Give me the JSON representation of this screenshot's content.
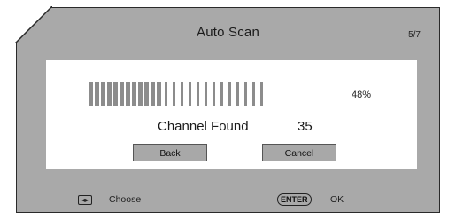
{
  "header": {
    "title": "Auto Scan",
    "page_indicator": "5/7"
  },
  "scan": {
    "progress_percent": 48,
    "progress_label": "48%",
    "channel_found_label": "Channel Found",
    "channel_found_count": "35"
  },
  "buttons": {
    "back_label": "Back",
    "cancel_label": "Cancel"
  },
  "footer": {
    "choose_icon": "left-right-arrows-icon",
    "choose_icon_glyph": "◂▸",
    "choose_label": "Choose",
    "enter_key_label": "ENTER",
    "ok_label": "OK"
  },
  "colors": {
    "frame": "#a9a9a9",
    "panel": "#ffffff",
    "progress_fill": "#8c8c8c",
    "button": "#a8a8a8"
  }
}
